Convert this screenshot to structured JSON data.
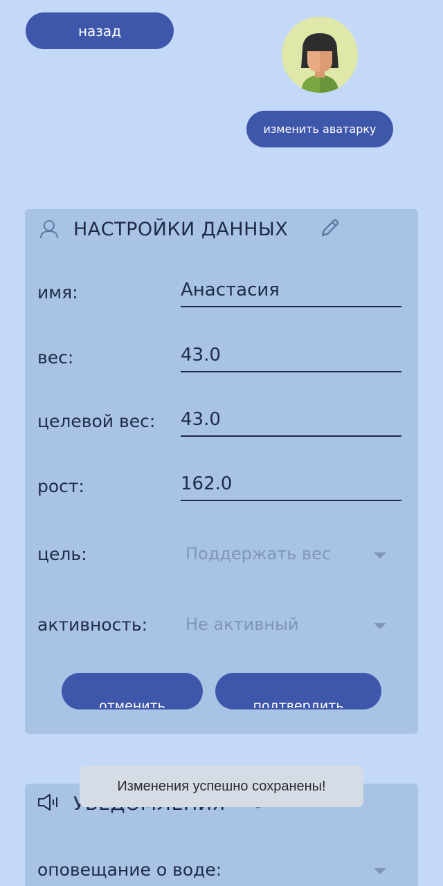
{
  "header": {
    "back_label": "назад",
    "change_avatar_label": "изменить аватарку"
  },
  "data_settings": {
    "title": "НАСТРОЙКИ ДАННЫХ",
    "rows": [
      {
        "label": "имя:",
        "value": "Анастасия"
      },
      {
        "label": "вес:",
        "value": "43.0"
      },
      {
        "label": "целевой вес:",
        "value": "43.0"
      },
      {
        "label": "рост:",
        "value": "162.0"
      }
    ],
    "goal": {
      "label": "цель:",
      "selected": "Поддержать вес"
    },
    "activity": {
      "label": "активность:",
      "selected": "Не активный"
    },
    "cancel_label": "отменить",
    "confirm_label": "подтвердить"
  },
  "notifications": {
    "title": "УВЕДОМЛЕНИЯ",
    "water_label": "оповещание о воде:"
  },
  "toast": {
    "message": "Изменения успешно сохранены!"
  },
  "colors": {
    "background": "#c4d9f7",
    "card": "#a9c3e4",
    "accent": "#3f57ab"
  }
}
